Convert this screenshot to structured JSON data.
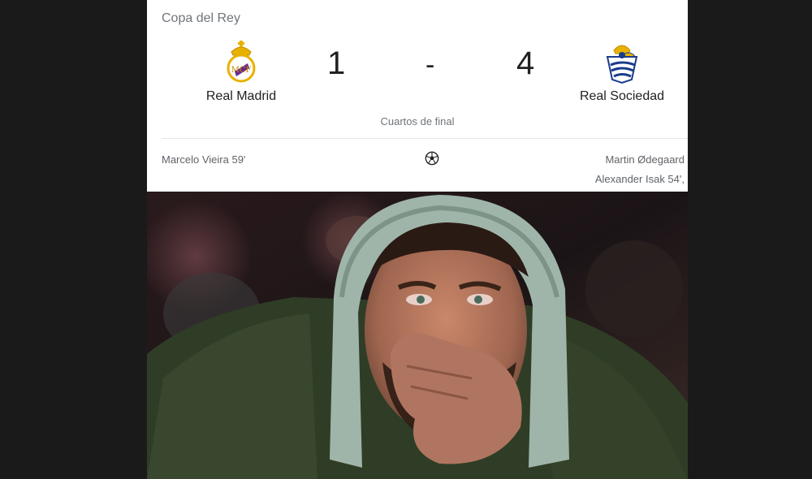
{
  "match": {
    "competition": "Copa del Rey",
    "stage": "Cuartos de final",
    "home": {
      "name": "Real Madrid",
      "score": "1",
      "crest_icon": "real-madrid-crest-icon"
    },
    "away": {
      "name": "Real Sociedad",
      "score": "4",
      "crest_icon": "real-sociedad-crest-icon"
    },
    "separator": "-",
    "goal_icon": "soccer-ball-icon",
    "home_scorers": [
      "Marcelo Vieira 59'"
    ],
    "away_scorers": [
      "Martin Ødegaard",
      "Alexander Isak 54',"
    ]
  },
  "photo": {
    "subject": "reaction-photo"
  },
  "colors": {
    "card_bg": "#ffffff",
    "text_primary": "#202124",
    "text_secondary": "#70757a",
    "page_bg": "#1a1a1a"
  }
}
